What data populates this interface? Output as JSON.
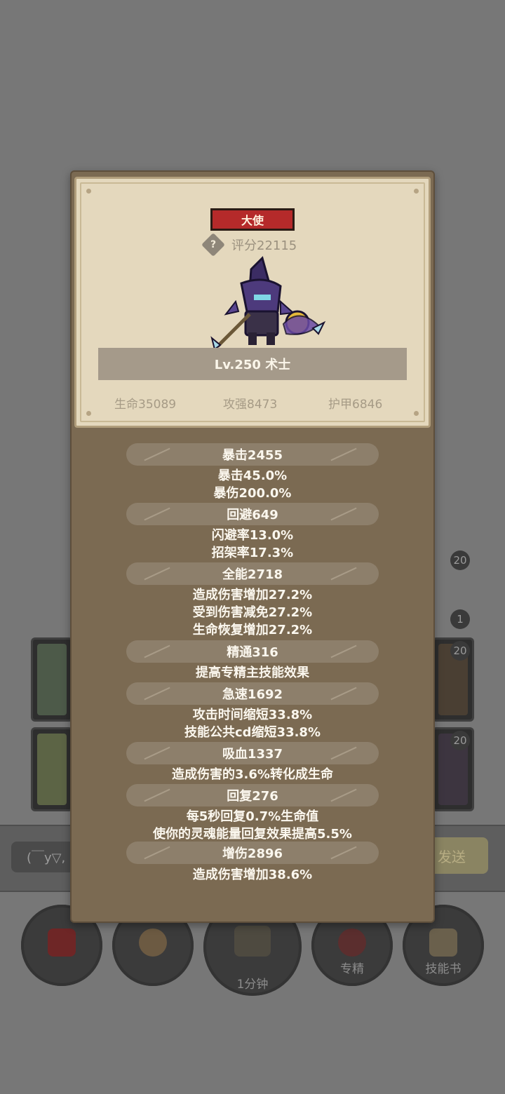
{
  "background": {
    "badges": [
      "20",
      "1",
      "20",
      "20"
    ],
    "chat_placeholder": "(￣y▽,",
    "send_label": "发送",
    "bottom_buttons": [
      {
        "label": "",
        "icon": "potion-icon"
      },
      {
        "label": "",
        "icon": "bread-icon"
      },
      {
        "label": "1分钟",
        "icon": "treasure-chest-icon"
      },
      {
        "label": "专精",
        "icon": "specialization-icon"
      },
      {
        "label": "技能书",
        "icon": "skill-book-icon"
      }
    ]
  },
  "hero": {
    "title_badge": "大使",
    "score": "评分22115",
    "name": "Lv.250 术士",
    "stats": {
      "hp": "生命35089",
      "attack": "攻强8473",
      "armor": "护甲6846"
    }
  },
  "details": [
    {
      "header": "暴击2455",
      "lines": [
        "暴击45.0%",
        "暴伤200.0%"
      ]
    },
    {
      "header": "回避649",
      "lines": [
        "闪避率13.0%",
        "招架率17.3%"
      ]
    },
    {
      "header": "全能2718",
      "lines": [
        "造成伤害增加27.2%",
        "受到伤害减免27.2%",
        "生命恢复增加27.2%"
      ]
    },
    {
      "header": "精通316",
      "lines": [
        "提高专精主技能效果"
      ]
    },
    {
      "header": "急速1692",
      "lines": [
        "攻击时间缩短33.8%",
        "技能公共cd缩短33.8%"
      ]
    },
    {
      "header": "吸血1337",
      "lines": [
        "造成伤害的3.6%转化成生命"
      ]
    },
    {
      "header": "回复276",
      "lines": [
        "每5秒回复0.7%生命值",
        "使你的灵魂能量回复效果提高5.5%"
      ]
    },
    {
      "header": "增伤2896",
      "lines": [
        "造成伤害增加38.6%"
      ]
    }
  ]
}
